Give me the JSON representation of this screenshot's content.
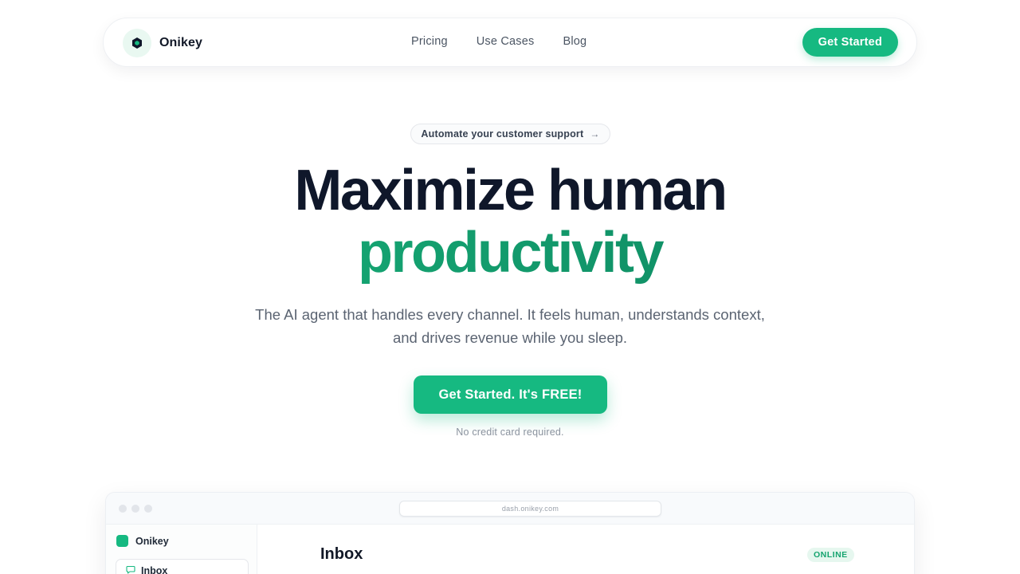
{
  "nav": {
    "brand": "Onikey",
    "links": [
      "Pricing",
      "Use Cases",
      "Blog"
    ],
    "cta": "Get Started"
  },
  "hero": {
    "pill": "Automate your customer support",
    "headline_line1": "Maximize human",
    "headline_line2": "productivity",
    "subcopy_line1": "The AI agent that handles every channel. It feels human, understands context,",
    "subcopy_line2": "and drives revenue while you sleep.",
    "cta": "Get Started. It's FREE!",
    "note": "No credit card required."
  },
  "preview": {
    "url": "dash.onikey.com",
    "sidebar_brand": "Onikey",
    "sidebar_item": "Inbox",
    "title": "Inbox",
    "status": "ONLINE"
  },
  "colors": {
    "accent": "#16b981",
    "accent_dark": "#0c7f5c",
    "text_dark": "#0f172a",
    "text_muted": "#5b6472"
  },
  "icons": {
    "logo": "hexagon-logo-icon",
    "pill_arrow": "arrow-right-icon",
    "window_controls": "window-dot-icon",
    "inbox": "chat-bubble-icon"
  }
}
